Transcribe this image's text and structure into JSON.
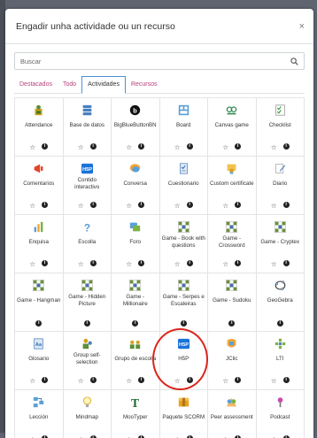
{
  "dialog": {
    "title": "Engadir unha actividade ou un recurso",
    "close_symbol": "×",
    "search_placeholder": "Buscar"
  },
  "tabs": [
    {
      "label": "Destacados",
      "active": false
    },
    {
      "label": "Todo",
      "active": false
    },
    {
      "label": "Actividades",
      "active": true
    },
    {
      "label": "Recursos",
      "active": false
    }
  ],
  "action_symbols": {
    "star": "☆",
    "info": "i"
  },
  "items": [
    {
      "label": "Attendance",
      "icon": "attendance-icon",
      "star": true
    },
    {
      "label": "Base de datos",
      "icon": "database-icon",
      "star": true
    },
    {
      "label": "BigBlueButtonBN",
      "icon": "bigbluebutton-icon",
      "star": true
    },
    {
      "label": "Board",
      "icon": "board-icon",
      "star": true
    },
    {
      "label": "Canvas game",
      "icon": "canvas-game-icon",
      "star": true
    },
    {
      "label": "Checklist",
      "icon": "checklist-icon",
      "star": true
    },
    {
      "label": "Comentarios",
      "icon": "feedback-icon",
      "star": true
    },
    {
      "label": "Contido interactivo",
      "icon": "h5p-icon",
      "star": true
    },
    {
      "label": "Conversa",
      "icon": "chat-icon",
      "star": true
    },
    {
      "label": "Cuestionario",
      "icon": "quiz-icon",
      "star": true
    },
    {
      "label": "Custom certificate",
      "icon": "certificate-icon",
      "star": true
    },
    {
      "label": "Diario",
      "icon": "journal-icon",
      "star": true
    },
    {
      "label": "Enquisa",
      "icon": "survey-icon",
      "star": true
    },
    {
      "label": "Escolla",
      "icon": "choice-icon",
      "star": true
    },
    {
      "label": "Foro",
      "icon": "forum-icon",
      "star": true
    },
    {
      "label": "Game - Book with questions",
      "icon": "game-icon",
      "star": true
    },
    {
      "label": "Game - Crossword",
      "icon": "game-icon",
      "star": true
    },
    {
      "label": "Game - Cryptex",
      "icon": "game-icon",
      "star": true
    },
    {
      "label": "Game - Hangman",
      "icon": "game-icon",
      "star": false
    },
    {
      "label": "Game - Hidden Picture",
      "icon": "game-icon",
      "star": false
    },
    {
      "label": "Game - Millionaire",
      "icon": "game-icon",
      "star": false
    },
    {
      "label": "Game - Serpes e Escaleiras",
      "icon": "game-icon",
      "star": false
    },
    {
      "label": "Game - Sudoku",
      "icon": "game-icon",
      "star": false
    },
    {
      "label": "GeoGebra",
      "icon": "geogebra-icon",
      "star": false
    },
    {
      "label": "Glosario",
      "icon": "glossary-icon",
      "star": true
    },
    {
      "label": "Group self-selection",
      "icon": "group-selection-icon",
      "star": true
    },
    {
      "label": "Grupo de escolla",
      "icon": "group-choice-icon",
      "star": true
    },
    {
      "label": "H5P",
      "icon": "h5p-icon",
      "star": true
    },
    {
      "label": "JClic",
      "icon": "jclic-icon",
      "star": true
    },
    {
      "label": "LTI",
      "icon": "lti-icon",
      "star": true
    },
    {
      "label": "Lección",
      "icon": "lesson-icon",
      "star": true
    },
    {
      "label": "Mindmap",
      "icon": "mindmap-icon",
      "star": true
    },
    {
      "label": "MooTyper",
      "icon": "mootyper-icon",
      "star": true
    },
    {
      "label": "Paquete SCORM",
      "icon": "scorm-icon",
      "star": true
    },
    {
      "label": "Peer assessment",
      "icon": "peer-assessment-icon",
      "star": true
    },
    {
      "label": "Podcast",
      "icon": "podcast-icon",
      "star": true
    }
  ]
}
